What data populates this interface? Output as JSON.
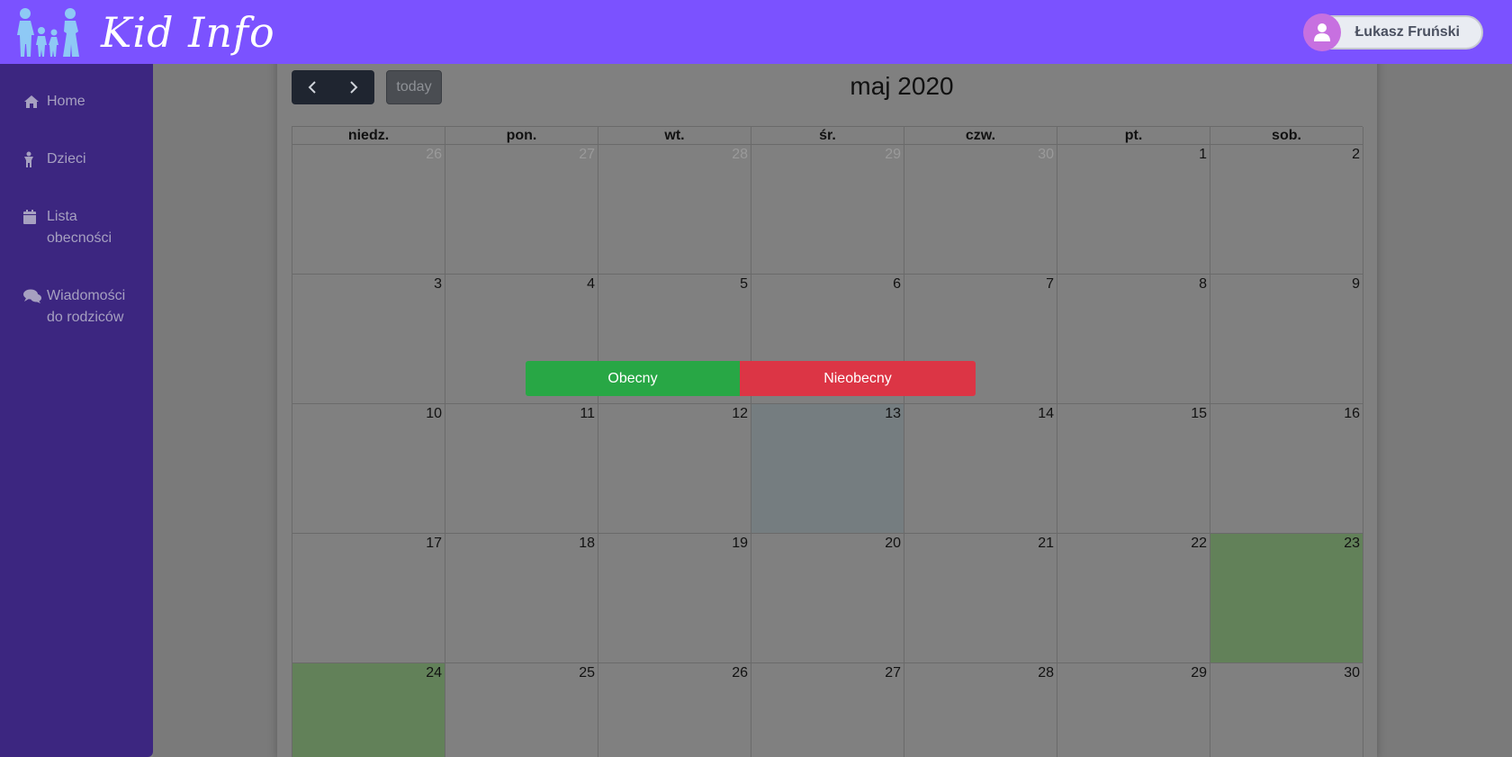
{
  "app": {
    "logo_text": "Kid Info"
  },
  "user": {
    "name": "Łukasz Fruński"
  },
  "sidebar": {
    "items": [
      {
        "label": "Home",
        "icon": "home-icon"
      },
      {
        "label": "Dzieci",
        "icon": "child-icon"
      },
      {
        "label": "Lista obecności",
        "icon": "calendar-icon"
      },
      {
        "label": "Wiadomości do rodziców",
        "icon": "comments-icon"
      }
    ]
  },
  "calendar": {
    "title": "maj 2020",
    "today_label": "today",
    "weekdays": [
      "niedz.",
      "pon.",
      "wt.",
      "śr.",
      "czw.",
      "pt.",
      "sob."
    ],
    "weeks": [
      [
        "26",
        "27",
        "28",
        "29",
        "30",
        "1",
        "2"
      ],
      [
        "3",
        "4",
        "5",
        "6",
        "7",
        "8",
        "9"
      ],
      [
        "10",
        "11",
        "12",
        "13",
        "14",
        "15",
        "16"
      ],
      [
        "17",
        "18",
        "19",
        "20",
        "21",
        "22",
        "23"
      ],
      [
        "24",
        "25",
        "26",
        "27",
        "28",
        "29",
        "30"
      ]
    ]
  },
  "popup": {
    "present_label": "Obecny",
    "absent_label": "Nieobecny"
  },
  "colors": {
    "accent": "#7b52ff",
    "sidebar": "#3c2680",
    "present": "#28a745",
    "absent": "#dc3545"
  }
}
